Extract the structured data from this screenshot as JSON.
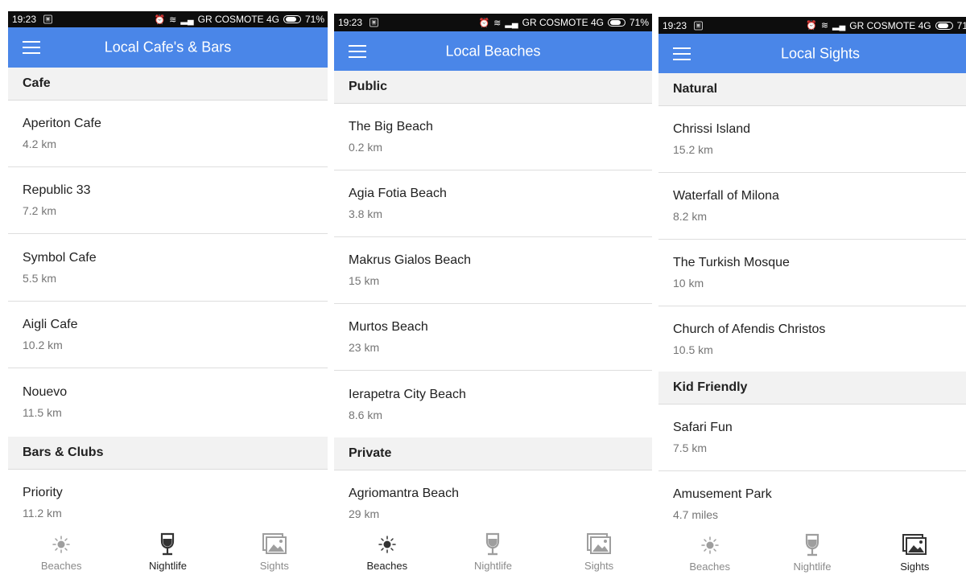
{
  "status_bar": {
    "time": "19:23",
    "carrier": "GR COSMOTE 4G",
    "battery": "71%",
    "battery_cut": "71"
  },
  "screens": [
    {
      "title": "Local Cafe's & Bars",
      "sections": [
        {
          "header": "Cafe",
          "items": [
            {
              "name": "Aperiton Cafe",
              "distance": "4.2 km"
            },
            {
              "name": "Republic 33",
              "distance": "7.2 km"
            },
            {
              "name": "Symbol Cafe",
              "distance": "5.5 km"
            },
            {
              "name": "Aigli Cafe",
              "distance": "10.2 km"
            },
            {
              "name": "Nouevo",
              "distance": "11.5 km"
            }
          ]
        },
        {
          "header": "Bars & Clubs",
          "items": [
            {
              "name": "Priority",
              "distance": "11.2 km"
            }
          ]
        }
      ],
      "active_tab": "nightlife"
    },
    {
      "title": "Local Beaches",
      "sections": [
        {
          "header": "Public",
          "items": [
            {
              "name": "The Big Beach",
              "distance": "0.2 km"
            },
            {
              "name": "Agia Fotia Beach",
              "distance": "3.8 km"
            },
            {
              "name": "Makrus Gialos Beach",
              "distance": "15 km"
            },
            {
              "name": "Murtos Beach",
              "distance": "23 km"
            },
            {
              "name": "Ierapetra City Beach",
              "distance": "8.6 km"
            }
          ]
        },
        {
          "header": "Private",
          "items": [
            {
              "name": "Agriomantra Beach",
              "distance": "29 km"
            }
          ]
        }
      ],
      "active_tab": "beaches"
    },
    {
      "title": "Local Sights",
      "sections": [
        {
          "header": "Natural",
          "items": [
            {
              "name": "Chrissi Island",
              "distance": "15.2 km"
            },
            {
              "name": "Waterfall of Milona",
              "distance": "8.2 km"
            },
            {
              "name": "The Turkish Mosque",
              "distance": "10 km"
            },
            {
              "name": "Church of Afendis Christos",
              "distance": "10.5 km"
            }
          ]
        },
        {
          "header": "Kid Friendly",
          "items": [
            {
              "name": "Safari Fun",
              "distance": "7.5 km"
            },
            {
              "name": "Amusement Park",
              "distance": "4.7 miles"
            }
          ]
        }
      ],
      "active_tab": "sights"
    }
  ],
  "bottom_nav": {
    "tabs": [
      {
        "id": "beaches",
        "label": "Beaches",
        "icon": "sun-icon"
      },
      {
        "id": "nightlife",
        "label": "Nightlife",
        "icon": "wine-glass-icon"
      },
      {
        "id": "sights",
        "label": "Sights",
        "icon": "photos-icon"
      }
    ]
  },
  "colors": {
    "app_bar": "#4a86e8",
    "status_bar": "#0d0d0d",
    "section_bg": "#f2f2f2",
    "active_icon": "#333333",
    "inactive_icon": "#9e9e9e"
  }
}
